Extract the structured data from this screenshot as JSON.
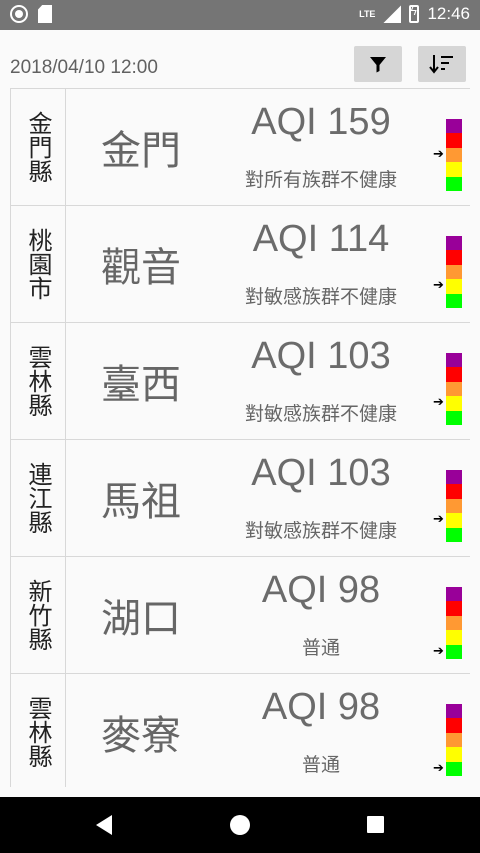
{
  "status_bar": {
    "icons": [
      "radio-circle-icon",
      "sd-card-icon",
      "lte-signal-icon",
      "battery-charging-icon"
    ],
    "network": "LTE",
    "time": "12:46"
  },
  "toolbar": {
    "timestamp": "2018/04/10 12:00",
    "filter_icon": "filter-icon",
    "sort_icon": "sort-icon"
  },
  "scale_colors": [
    "#990099",
    "#ff0000",
    "#ff9933",
    "#ffff00",
    "#00ff00"
  ],
  "stations": [
    {
      "county": "金門縣",
      "station": "金門",
      "aqi": "AQI 159",
      "status": "對所有族群不健康",
      "level": 2
    },
    {
      "county": "桃園市",
      "station": "觀音",
      "aqi": "AQI 114",
      "status": "對敏感族群不健康",
      "level": 3
    },
    {
      "county": "雲林縣",
      "station": "臺西",
      "aqi": "AQI 103",
      "status": "對敏感族群不健康",
      "level": 3
    },
    {
      "county": "連江縣",
      "station": "馬祖",
      "aqi": "AQI 103",
      "status": "對敏感族群不健康",
      "level": 3
    },
    {
      "county": "新竹縣",
      "station": "湖口",
      "aqi": "AQI 98",
      "status": "普通",
      "level": 4
    },
    {
      "county": "雲林縣",
      "station": "麥寮",
      "aqi": "AQI 98",
      "status": "普通",
      "level": 4
    }
  ],
  "nav": {
    "back_icon": "back-triangle-icon",
    "home_icon": "home-circle-icon",
    "recents_icon": "recents-square-icon"
  }
}
